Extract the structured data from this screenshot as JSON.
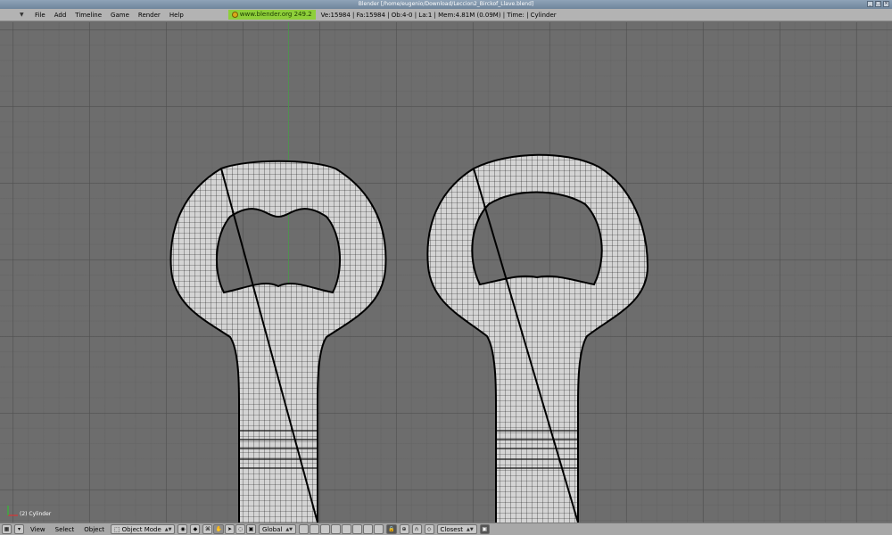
{
  "window": {
    "title": "Blender [/home/eugenio/Download/Leccion2_Birckof_Llave.blend]",
    "buttons": [
      "_",
      "□",
      "×"
    ]
  },
  "info_header": {
    "menu": [
      "File",
      "Add",
      "Timeline",
      "Game",
      "Render",
      "Help"
    ],
    "url_badge": "www.blender.org 249.2",
    "stats": "Ve:15984 | Fa:15984 | Ob:4-0 | La:1  | Mem:4.81M (0.09M) | Time: | Cylinder"
  },
  "viewport": {
    "object_label": "(2) Cylinder"
  },
  "view3d_header": {
    "menu": [
      "View",
      "Select",
      "Object"
    ],
    "mode": "Object Mode",
    "orientation": "Global",
    "snap_target": "Closest"
  },
  "colors": {
    "viewport_bg": "#6d6d6d",
    "header_bg": "#b3b3b3",
    "url_badge": "#8ecf3a",
    "mesh_fill": "#d4d4d4",
    "wire": "#111111"
  }
}
